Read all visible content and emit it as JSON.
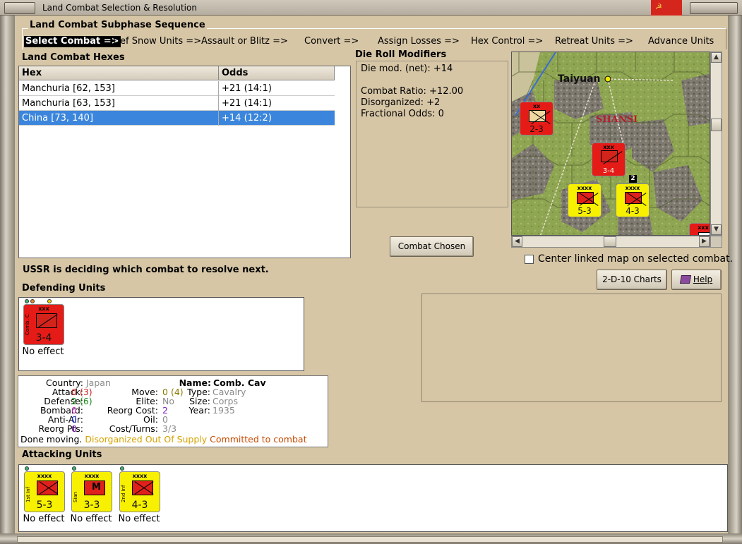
{
  "window": {
    "title": "Land Combat Selection & Resolution"
  },
  "subphase": {
    "title": "Land Combat Subphase Sequence",
    "steps": [
      "Select Combat =>",
      "Def Snow Units =>",
      "Assault or Blitz =>",
      "Convert =>",
      "Assign Losses =>",
      "Hex Control =>",
      "Retreat Units =>",
      "Advance Units"
    ]
  },
  "hexes": {
    "title": "Land Combat Hexes",
    "columns": [
      "Hex",
      "Odds"
    ],
    "rows": [
      {
        "hex": "Manchuria [62, 153]",
        "odds": "+21 (14:1)"
      },
      {
        "hex": "Manchuria [63, 153]",
        "odds": "+21 (14:1)"
      },
      {
        "hex": "China [73, 140]",
        "odds": "+14 (12:2)"
      }
    ],
    "selected_index": 2
  },
  "die_roll": {
    "title": "Die Roll Modifiers",
    "lines": [
      "Die mod. (net): +14",
      "",
      "Combat Ratio: +12.00",
      "Disorganized: +2",
      "Fractional Odds: 0"
    ]
  },
  "map": {
    "city": "Taiyuan",
    "region": "SHANSI",
    "units": [
      {
        "name": "",
        "size": "xx",
        "strength": "2-3",
        "color": "red"
      },
      {
        "name": "Comb. Cav",
        "size": "xxx",
        "strength": "3-4",
        "color": "red"
      },
      {
        "name": "1st Inf",
        "size": "xxxx",
        "strength": "5-3",
        "color": "yellow"
      },
      {
        "name": "2nd Inf",
        "size": "xxxx",
        "strength": "4-3",
        "color": "yellow"
      },
      {
        "name": "",
        "size": "xxx",
        "strength": "",
        "color": "red"
      }
    ],
    "stack_count": "2"
  },
  "buttons": {
    "combat_chosen": "Combat Chosen",
    "charts": "2-D-10 Charts",
    "help": "Help"
  },
  "center_link_label": "Center linked map on selected combat.",
  "status_message": "USSR is deciding which combat to resolve next.",
  "defending": {
    "title": "Defending Units",
    "units": [
      {
        "name": "Comb. Cav",
        "size": "xxx",
        "strength": "3-4",
        "result": "No effect"
      }
    ]
  },
  "unit_info": {
    "country_label": "Country:",
    "country": "Japan",
    "attack_label": "Attack:",
    "attack": "0",
    "attack_base": "(3)",
    "defense_label": "Defense:",
    "defense": "2",
    "defense_base": "(6)",
    "bombard_label": "Bombard:",
    "bombard": "0",
    "antiair_label": "Anti-Air:",
    "antiair": "0",
    "reorg_pts_label": "Reorg Pts:",
    "reorg_pts": "0",
    "move_label": "Move:",
    "move": "0",
    "move_base": "(4)",
    "elite_label": "Elite:",
    "elite": "No",
    "reorg_cost_label": "Reorg Cost:",
    "reorg_cost": "2",
    "oil_label": "Oil:",
    "oil": "0",
    "cost_label": "Cost/Turns:",
    "cost": "3/3",
    "name_label": "Name:",
    "name": "Comb. Cav",
    "type_label": "Type:",
    "type": "Cavalry",
    "size_label": "Size:",
    "size": "Corps",
    "year_label": "Year:",
    "year": "1935",
    "status_done": "Done moving.",
    "status_disorg": "Disorganized",
    "status_supply": "Out Of Supply",
    "status_committed": "Committed to combat"
  },
  "attacking": {
    "title": "Attacking Units",
    "units": [
      {
        "name": "1st Inf",
        "size": "xxxx",
        "strength": "5-3",
        "result": "No effect"
      },
      {
        "name": "Sian",
        "size": "xxxx",
        "strength": "3-3",
        "symbol": "M",
        "result": "No effect"
      },
      {
        "name": "2nd Inf",
        "size": "xxxx",
        "strength": "4-3",
        "result": "No effect"
      }
    ]
  },
  "colors": {
    "selection": "#3b86dc",
    "defender": "#e51b17",
    "attacker": "#f7f000",
    "disorganized": "#d4a200",
    "committed": "#c84a00"
  }
}
